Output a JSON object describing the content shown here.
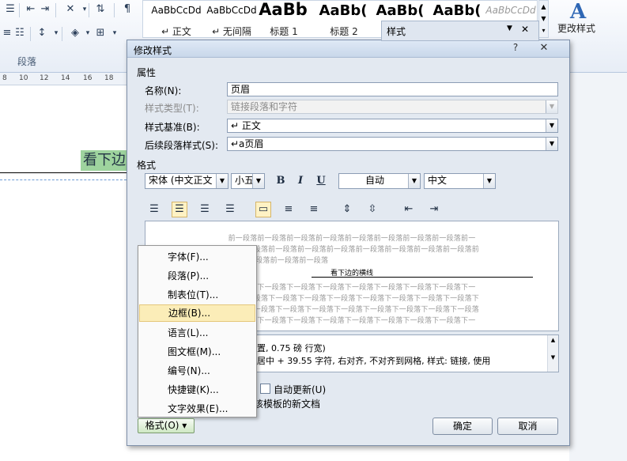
{
  "ribbon": {
    "group_label": "段落",
    "style_gallery": [
      {
        "sample": "AaBbCcDd",
        "name": "↵ 正文"
      },
      {
        "sample": "AaBbCcDd",
        "name": "↵ 无间隔"
      },
      {
        "sample": "AaBb",
        "name": "标题 1"
      },
      {
        "sample": "AaBb(",
        "name": "标题 2"
      },
      {
        "sample": "AaBb(",
        "name": ""
      },
      {
        "sample": "AaBb(",
        "name": ""
      },
      {
        "sample": "AaBbCcDd",
        "name": ""
      }
    ],
    "change_styles_label": "更改样式",
    "styles_pane_title": "样式"
  },
  "ruler": {
    "ticks": [
      "8",
      "10",
      "12",
      "14",
      "16",
      "18"
    ]
  },
  "document": {
    "heading_text": "看下边"
  },
  "dialog": {
    "title": "修改样式",
    "help": "?",
    "close": "✕",
    "properties_header": "属性",
    "name_label": "名称(N):",
    "name_value": "页眉",
    "style_type_label": "样式类型(T):",
    "style_type_value": "链接段落和字符",
    "based_on_label": "样式基准(B):",
    "based_on_value": "↵ 正文",
    "following_label": "后续段落样式(S):",
    "following_value": "↵a页眉",
    "format_header": "格式",
    "font_value": "宋体 (中文正文",
    "size_value": "小五",
    "bold": "B",
    "italic": "I",
    "underline": "U",
    "color_value": "自动",
    "language_value": "中文",
    "preview": {
      "prev_lines": [
        "前一段落前一段落前一段落前一段落前一段落前一段落前一段落前一段落前一",
        "段落前一段落前一段落前一段落前一段落前一段落前一段落前一段落前一段落前",
        "一段落前一段落前一段落"
      ],
      "sample_text": "看下边的横线",
      "next_lines": [
        "下一段落下一段落下一段落下一段落下一段落下一段落下一段落下一段落下一",
        "段落下一段落下一段落下一段落下一段落下一段落下一段落下一段落下一段落下",
        "一段落下一段落下一段落下一段落下一段落下一段落下一段落下一段落下一段落",
        "下一段落下一段落下一段落下一段落下一段落下一段落下一段落下一段落下一"
      ]
    },
    "description_line1": "设置, 0.75 磅 行宽)",
    "description_line2": "、居中 + 39.55 字符, 右对齐, 不对齐到网格, 样式: 链接, 使用",
    "auto_update_label": "自动更新(U)",
    "template_label": "该模板的新文档",
    "ok_label": "确定",
    "cancel_label": "取消",
    "format_button_label": "格式(O) ▾"
  },
  "format_menu": {
    "items": [
      "字体(F)...",
      "段落(P)...",
      "制表位(T)...",
      "边框(B)...",
      "语言(L)...",
      "图文框(M)...",
      "编号(N)...",
      "快捷键(K)...",
      "文字效果(E)..."
    ],
    "highlighted_index": 3
  }
}
